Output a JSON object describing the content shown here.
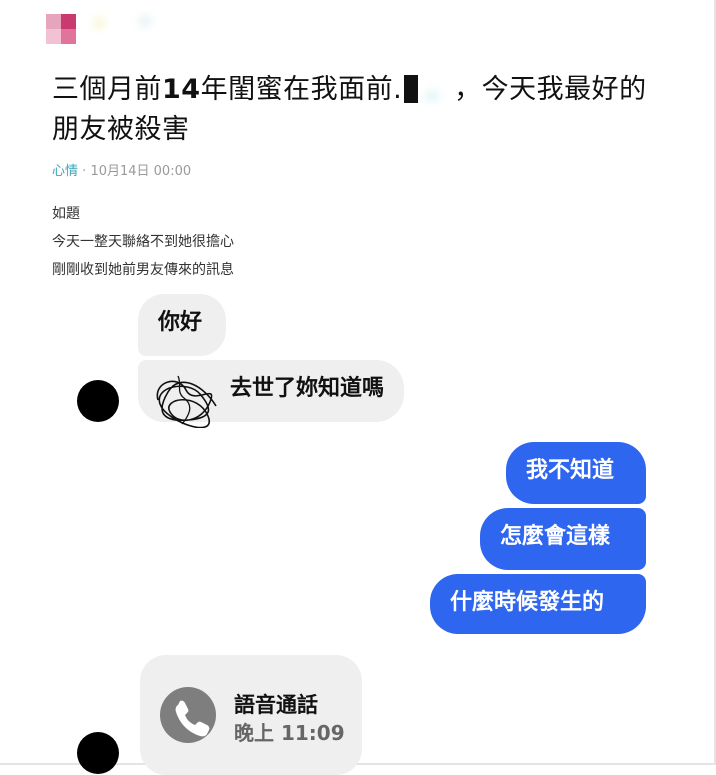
{
  "post": {
    "title_part1": "三個月前",
    "title_num": "14",
    "title_part2": "年閨蜜在我面前.",
    "title_part3": "，今天我最好的",
    "title_line2": "朋友被殺害",
    "category": "心情",
    "separator": "·",
    "date": "10月14日 00:00",
    "body_lines": [
      "如題",
      "今天一整天聯絡不到她很擔心",
      "剛剛收到她前男友傳來的訊息"
    ]
  },
  "chat": {
    "left_messages": [
      "你好",
      "去世了妳知道嗎"
    ],
    "right_messages": [
      "我不知道",
      "怎麼會這樣",
      "什麼時候發生的"
    ],
    "call": {
      "title": "語音通話",
      "time": "晚上 11:09",
      "icon": "phone-icon"
    }
  },
  "colors": {
    "bubble_blue": "#2f66f0",
    "bubble_gray": "#efefef",
    "category": "#3aa4b5"
  }
}
